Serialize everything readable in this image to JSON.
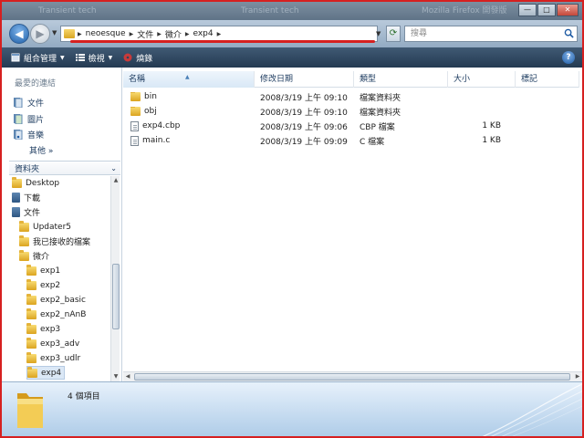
{
  "titlebar": {
    "ghost_left": "Transient tech",
    "ghost_mid": "Transient tech",
    "ghost_right": "Mozilla Firefox 開發版",
    "minimize": "—",
    "maximize": "□",
    "close": "✕"
  },
  "address": {
    "crumbs": [
      "neoesque",
      "文件",
      "微介",
      "exp4"
    ],
    "search_placeholder": "搜尋"
  },
  "commands": {
    "organize": "組合管理",
    "views": "檢視",
    "burn": "燒錄",
    "help": "?"
  },
  "favorites": {
    "heading": "最愛的連結",
    "items": [
      "文件",
      "圖片",
      "音樂"
    ],
    "more": "其他 »"
  },
  "folders": {
    "heading": "資料夾",
    "items": [
      {
        "label": "Desktop",
        "indent": 0,
        "icon": "folder-icon"
      },
      {
        "label": "下載",
        "indent": 0,
        "icon": "document-folder-icon"
      },
      {
        "label": "文件",
        "indent": 0,
        "icon": "document-folder-icon"
      },
      {
        "label": "Updater5",
        "indent": 1,
        "icon": "folder-icon"
      },
      {
        "label": "我已接收的檔案",
        "indent": 1,
        "icon": "folder-icon"
      },
      {
        "label": "微介",
        "indent": 1,
        "icon": "folder-icon"
      },
      {
        "label": "exp1",
        "indent": 2,
        "icon": "folder-icon"
      },
      {
        "label": "exp2",
        "indent": 2,
        "icon": "folder-icon"
      },
      {
        "label": "exp2_basic",
        "indent": 2,
        "icon": "folder-icon"
      },
      {
        "label": "exp2_nAnB",
        "indent": 2,
        "icon": "folder-icon"
      },
      {
        "label": "exp3",
        "indent": 2,
        "icon": "folder-icon"
      },
      {
        "label": "exp3_adv",
        "indent": 2,
        "icon": "folder-icon"
      },
      {
        "label": "exp3_udlr",
        "indent": 2,
        "icon": "folder-icon"
      },
      {
        "label": "exp4",
        "indent": 2,
        "icon": "folder-icon",
        "selected": true
      }
    ]
  },
  "columns": [
    "名稱",
    "修改日期",
    "類型",
    "大小",
    "標記"
  ],
  "files": [
    {
      "name": "bin",
      "date": "2008/3/19 上午 09:10",
      "type": "檔案資料夾",
      "size": "",
      "kind": "folder"
    },
    {
      "name": "obj",
      "date": "2008/3/19 上午 09:10",
      "type": "檔案資料夾",
      "size": "",
      "kind": "folder"
    },
    {
      "name": "exp4.cbp",
      "date": "2008/3/19 上午 09:06",
      "type": "CBP 檔案",
      "size": "1 KB",
      "kind": "file"
    },
    {
      "name": "main.c",
      "date": "2008/3/19 上午 09:09",
      "type": "C 檔案",
      "size": "1 KB",
      "kind": "file"
    }
  ],
  "details": {
    "count": "4 個項目"
  },
  "colors": {
    "highlight_underline": "#d62020",
    "command_bar": "#2e455e",
    "selection": "#dbe8f6"
  }
}
